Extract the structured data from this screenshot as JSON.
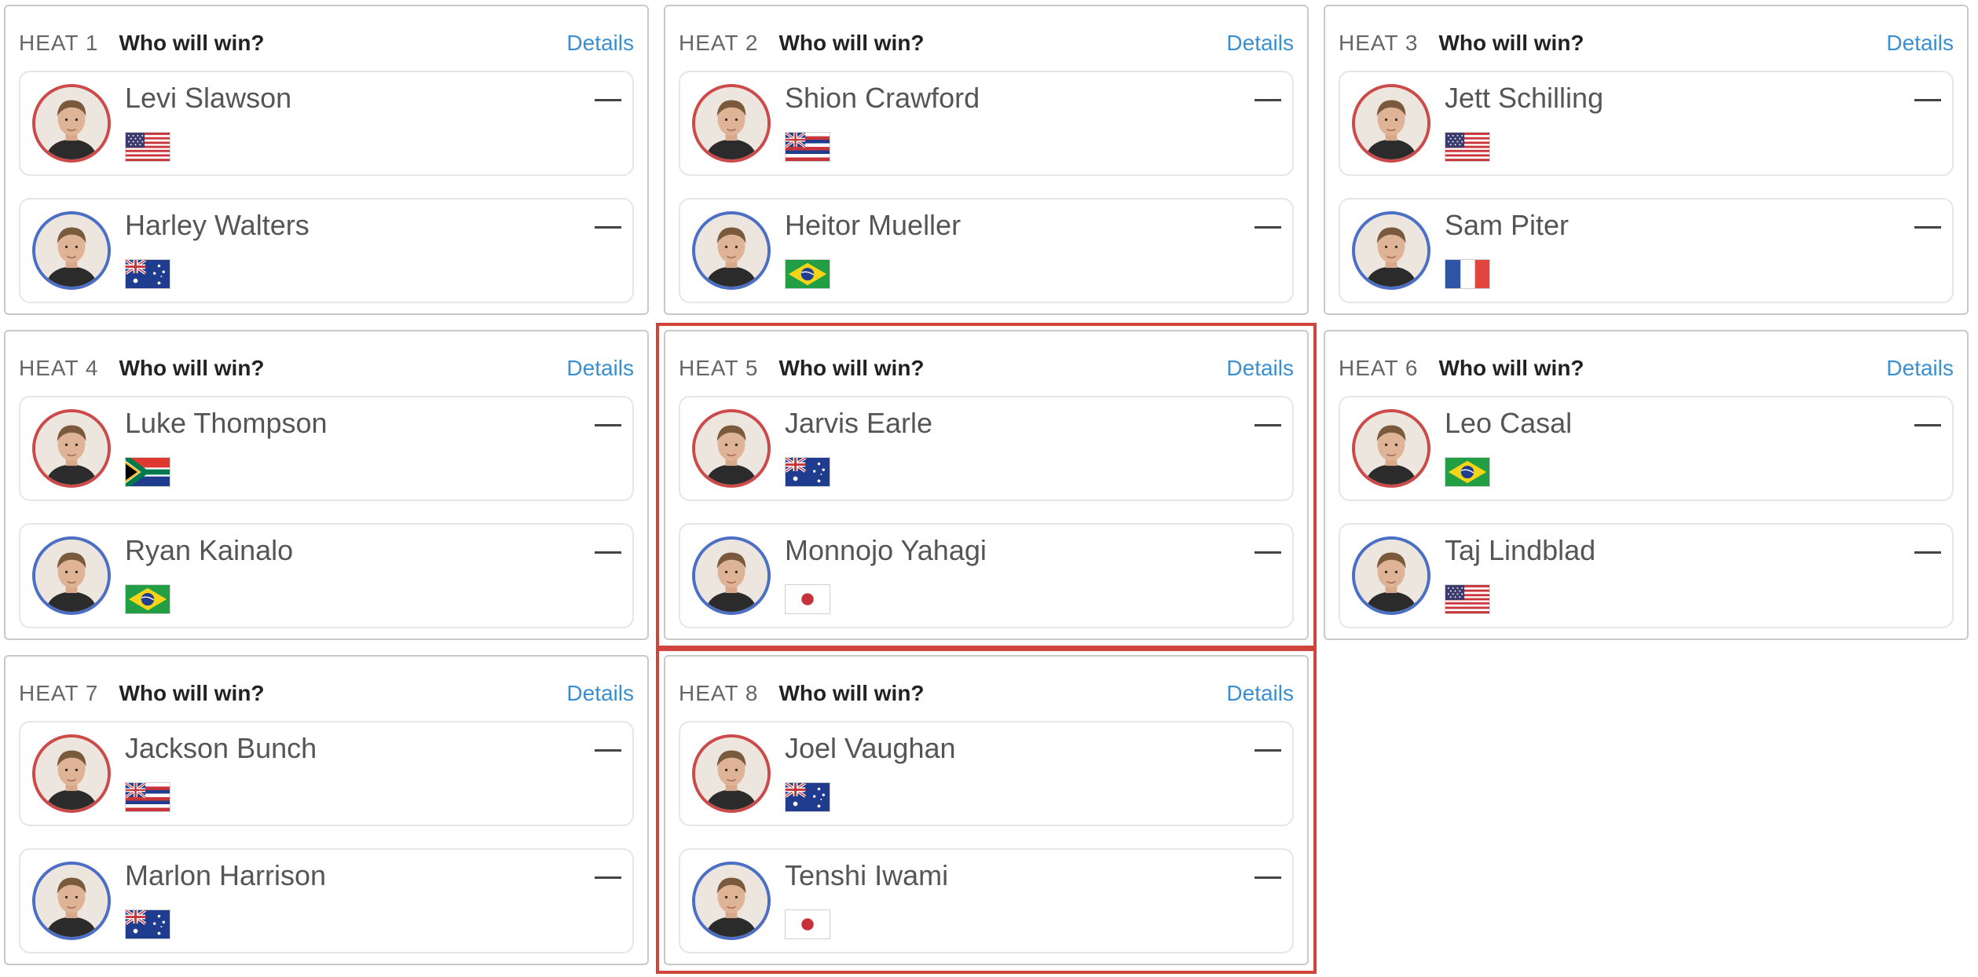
{
  "heats": [
    {
      "label": "HEAT 1",
      "question": "Who will win?",
      "details": "Details",
      "highlighted": false,
      "surfers": [
        {
          "name": "Levi Slawson",
          "country": "USA",
          "flag": "us-flag-icon",
          "pick": "—"
        },
        {
          "name": "Harley Walters",
          "country": "Australia",
          "flag": "australia-flag-icon",
          "pick": "—"
        }
      ]
    },
    {
      "label": "HEAT 2",
      "question": "Who will win?",
      "details": "Details",
      "highlighted": false,
      "surfers": [
        {
          "name": "Shion Crawford",
          "country": "Hawaii",
          "flag": "hawaii-flag-icon",
          "pick": "—"
        },
        {
          "name": "Heitor Mueller",
          "country": "Brazil",
          "flag": "brazil-flag-icon",
          "pick": "—"
        }
      ]
    },
    {
      "label": "HEAT 3",
      "question": "Who will win?",
      "details": "Details",
      "highlighted": false,
      "surfers": [
        {
          "name": "Jett Schilling",
          "country": "USA",
          "flag": "us-flag-icon",
          "pick": "—"
        },
        {
          "name": "Sam Piter",
          "country": "France",
          "flag": "france-flag-icon",
          "pick": "—"
        }
      ]
    },
    {
      "label": "HEAT 4",
      "question": "Who will win?",
      "details": "Details",
      "highlighted": false,
      "surfers": [
        {
          "name": "Luke Thompson",
          "country": "South Africa",
          "flag": "south-africa-flag-icon",
          "pick": "—"
        },
        {
          "name": "Ryan Kainalo",
          "country": "Brazil",
          "flag": "brazil-flag-icon",
          "pick": "—"
        }
      ]
    },
    {
      "label": "HEAT 5",
      "question": "Who will win?",
      "details": "Details",
      "highlighted": true,
      "surfers": [
        {
          "name": "Jarvis Earle",
          "country": "Australia",
          "flag": "australia-flag-icon",
          "pick": "—"
        },
        {
          "name": "Monnojo Yahagi",
          "country": "Japan",
          "flag": "japan-flag-icon",
          "pick": "—"
        }
      ]
    },
    {
      "label": "HEAT 6",
      "question": "Who will win?",
      "details": "Details",
      "highlighted": false,
      "surfers": [
        {
          "name": "Leo Casal",
          "country": "Brazil",
          "flag": "brazil-flag-icon",
          "pick": "—"
        },
        {
          "name": "Taj Lindblad",
          "country": "USA",
          "flag": "us-flag-icon",
          "pick": "—"
        }
      ]
    },
    {
      "label": "HEAT 7",
      "question": "Who will win?",
      "details": "Details",
      "highlighted": false,
      "surfers": [
        {
          "name": "Jackson Bunch",
          "country": "Hawaii",
          "flag": "hawaii-flag-icon",
          "pick": "—"
        },
        {
          "name": "Marlon Harrison",
          "country": "Australia",
          "flag": "australia-flag-icon",
          "pick": "—"
        }
      ]
    },
    {
      "label": "HEAT 8",
      "question": "Who will win?",
      "details": "Details",
      "highlighted": true,
      "surfers": [
        {
          "name": "Joel Vaughan",
          "country": "Australia",
          "flag": "australia-flag-icon",
          "pick": "—"
        },
        {
          "name": "Tenshi Iwami",
          "country": "Japan",
          "flag": "japan-flag-icon",
          "pick": "—"
        }
      ]
    }
  ],
  "colors": {
    "details_link": "#3a8fd1",
    "highlight_border": "#d0453b",
    "surfer1_ring": "#cc4a4a",
    "surfer2_ring": "#4a6fc4",
    "card_border": "#c9c9c9"
  }
}
